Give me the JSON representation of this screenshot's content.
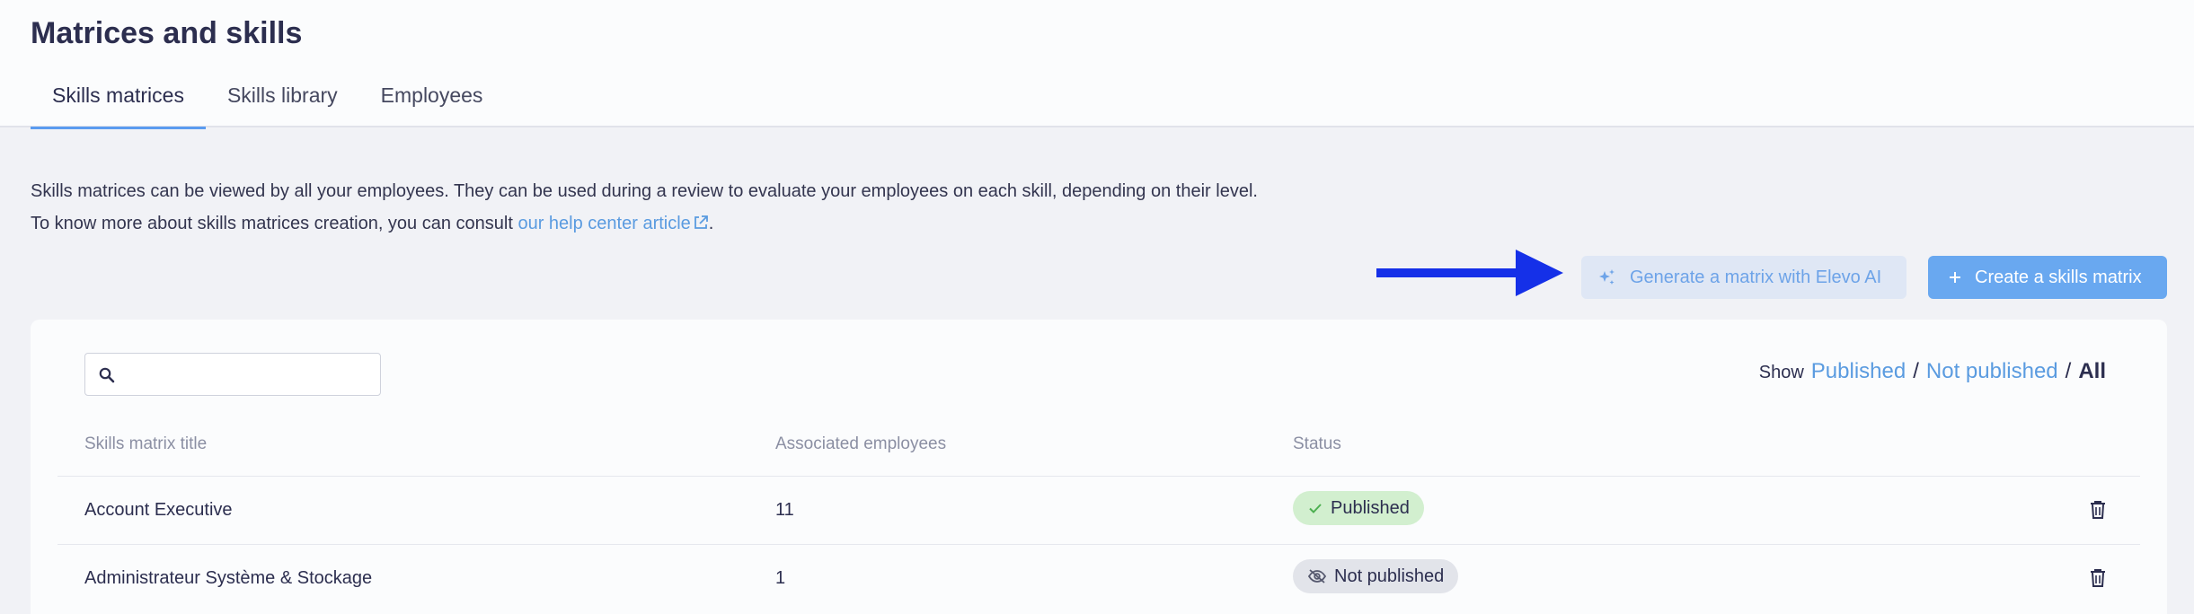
{
  "header": {
    "title": "Matrices and skills",
    "tabs": [
      {
        "label": "Skills matrices",
        "active": true
      },
      {
        "label": "Skills library",
        "active": false
      },
      {
        "label": "Employees",
        "active": false
      }
    ]
  },
  "intro": {
    "line1": "Skills matrices can be viewed by all your employees. They can be used during a review to evaluate your employees on each skill, depending on their level.",
    "line2_prefix": "To know more about skills matrices creation, you can consult ",
    "link_label": "our help center article",
    "line2_suffix": "."
  },
  "actions": {
    "generate_ai_label": "Generate a matrix with Elevo AI",
    "create_label": "Create a skills matrix"
  },
  "search": {
    "value": "",
    "placeholder": ""
  },
  "filter": {
    "show_label": "Show",
    "options": [
      "Published",
      "Not published",
      "All"
    ],
    "separator": "/",
    "selected": "All"
  },
  "table": {
    "columns": [
      "Skills matrix title",
      "Associated employees",
      "Status"
    ],
    "rows": [
      {
        "title": "Account Executive",
        "employees": "11",
        "status": "Published"
      },
      {
        "title": "Administrateur Système & Stockage",
        "employees": "1",
        "status": "Not published"
      }
    ]
  },
  "colors": {
    "accent": "#5a9be0",
    "arrow": "#1530e8",
    "published_bg": "#d2efcf",
    "unpublished_bg": "#e2e4ea"
  },
  "icons": [
    "external-link-icon",
    "sparkle-icon",
    "plus-icon",
    "search-icon",
    "check-icon",
    "eye-off-icon",
    "trash-icon",
    "arrow-annotation-icon"
  ]
}
